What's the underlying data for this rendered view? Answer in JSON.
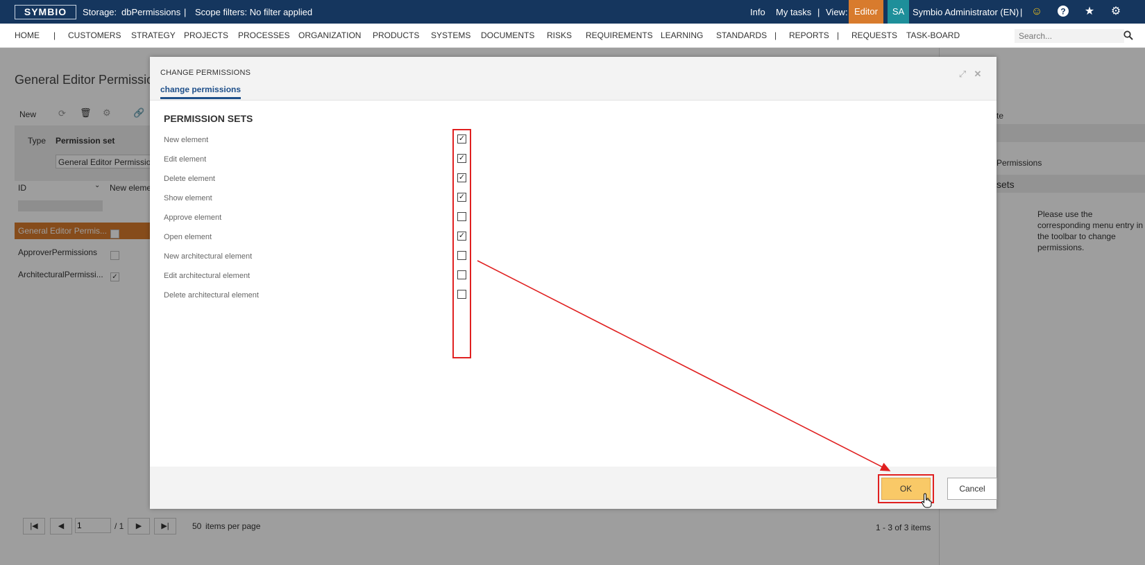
{
  "topbar": {
    "logo": "SYMBIO",
    "storage_label": "Storage:",
    "storage_value": "dbPermissions",
    "sep1": "|",
    "scope": "Scope filters: No filter applied",
    "info": "Info",
    "my_tasks": "My tasks",
    "sep2": "|",
    "view_label": "View:",
    "view_value": "Editor",
    "avatar": "SA",
    "user": "Symbio Administrator (EN)",
    "sep3": "|",
    "icons": [
      "smiley-icon",
      "help-icon",
      "star-icon",
      "gear-icon"
    ]
  },
  "nav": {
    "items": [
      "HOME",
      "|",
      "CUSTOMERS",
      "STRATEGY",
      "PROJECTS",
      "PROCESSES",
      "ORGANIZATION",
      "PRODUCTS",
      "SYSTEMS",
      "DOCUMENTS",
      "RISKS",
      "REQUIREMENTS",
      "LEARNING",
      "STANDARDS",
      "|",
      "REPORTS",
      "|",
      "REQUESTS",
      "TASK-BOARD"
    ],
    "search_placeholder": "Search..."
  },
  "background": {
    "page_title": "General Editor Permissions",
    "toolbar_new": "New",
    "col_type": "Type",
    "col_permission_set": "Permission set",
    "filter_value": "General Editor Permissions",
    "col_id": "ID",
    "col_new_element": "New element",
    "rows": [
      {
        "name": "General Editor Permis...",
        "checked": false,
        "selected": true
      },
      {
        "name": "ApproverPermissions",
        "checked": false,
        "selected": false
      },
      {
        "name": "ArchitecturalPermissi...",
        "checked": true,
        "selected": false
      }
    ],
    "right_header": "te",
    "right_item": "Permissions",
    "right_section": "sets",
    "right_info": "Please use the corresponding menu entry in the toolbar to change permissions.",
    "pager_page": "1",
    "pager_total": "/ 1",
    "pager_size": "50",
    "pager_size_label": "items per page",
    "pager_summary": "1 - 3 of 3 items"
  },
  "modal": {
    "title": "CHANGE PERMISSIONS",
    "tab": "change permissions",
    "section_title": "PERMISSION SETS",
    "permissions": [
      {
        "label": "New element",
        "checked": true
      },
      {
        "label": "Edit element",
        "checked": true
      },
      {
        "label": "Delete element",
        "checked": true
      },
      {
        "label": "Show element",
        "checked": true
      },
      {
        "label": "Approve element",
        "checked": false
      },
      {
        "label": "Open element",
        "checked": true
      },
      {
        "label": "New architectural element",
        "checked": false
      },
      {
        "label": "Edit architectural element",
        "checked": false
      },
      {
        "label": "Delete architectural element",
        "checked": false
      }
    ],
    "ok_label": "OK",
    "cancel_label": "Cancel"
  },
  "colors": {
    "topbar": "#15365e",
    "editor_badge": "#d87b2d",
    "avatar": "#1e8f9a",
    "ok_button": "#f9c967",
    "highlight": "#e02020",
    "selected_row": "#d87b2d"
  }
}
